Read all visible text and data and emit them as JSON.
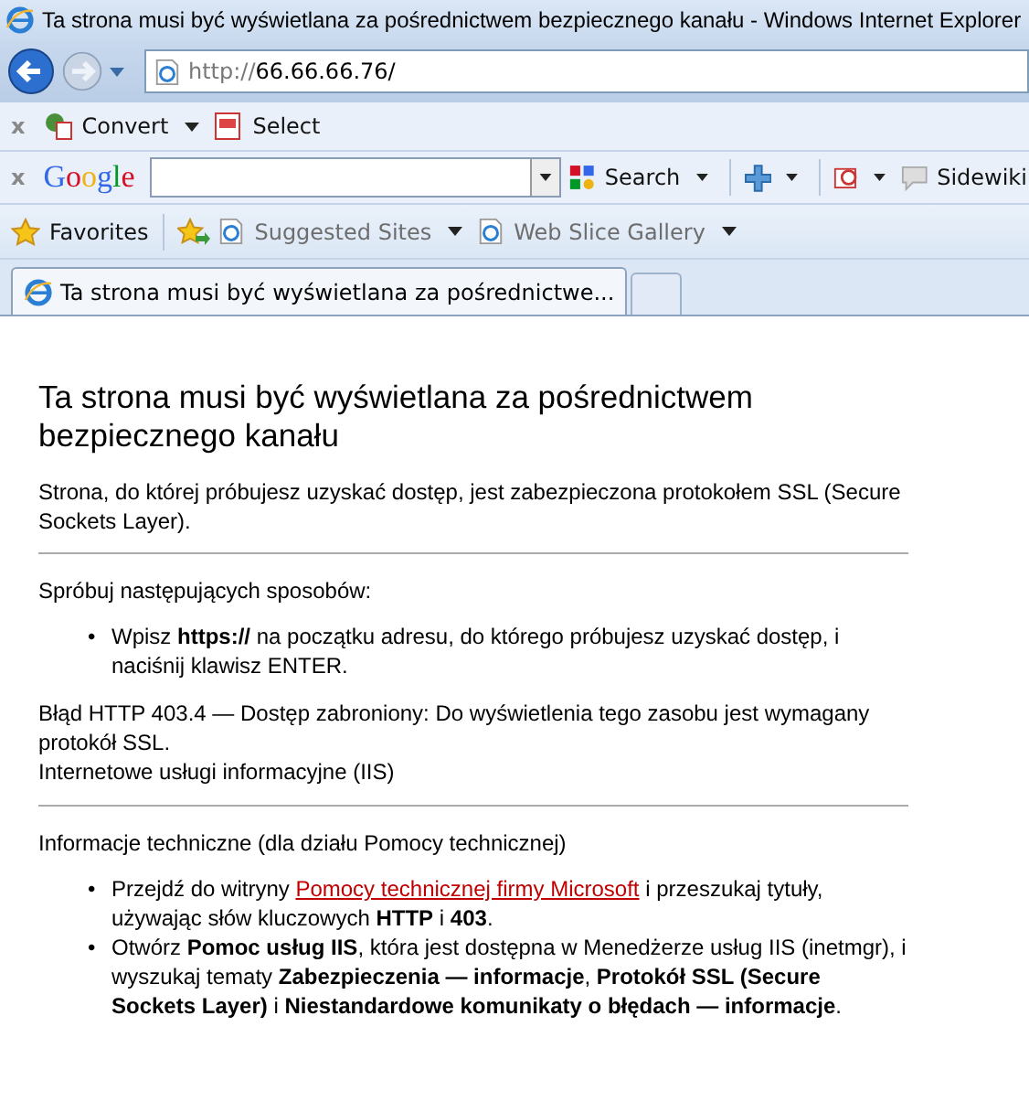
{
  "window": {
    "title": "Ta strona musi być wyświetlana za pośrednictwem bezpiecznego kanału - Windows Internet Explorer"
  },
  "address": {
    "value_dim": "http://",
    "value": "66.66.66.76/"
  },
  "convert_bar": {
    "close": "x",
    "items": [
      {
        "kind": "convert",
        "label": "Convert"
      },
      {
        "kind": "select",
        "label": "Select"
      }
    ]
  },
  "google_bar": {
    "close": "x",
    "logo": "Google",
    "search": "Search",
    "sidewiki": "Sidewiki"
  },
  "favorites_bar": {
    "favorites": "Favorites",
    "links": [
      "Suggested Sites",
      "Web Slice Gallery"
    ]
  },
  "tabs": [
    {
      "label": "Ta strona musi być wyświetlana za pośrednictwe...",
      "selected": true
    }
  ],
  "page": {
    "heading": "Ta strona musi być wyświetlana za pośrednictwem bezpiecznego kanału",
    "intro": "Strona, do której próbujesz uzyskać dostęp, jest zabezpieczona protokołem SSL (Secure Sockets Layer).",
    "try_heading": "Spróbuj następujących sposobów:",
    "try_items": [
      {
        "bullet": "•",
        "text": "Wpisz **https://** na początku adresu, do którego próbujesz uzyskać dostęp, i naciśnij klawisz ENTER."
      }
    ],
    "error": "Błąd HTTP 403.4 — Dostęp zabroniony: Do wyświetlenia tego zasobu jest wymagany protokół SSL.",
    "server": "Internetowe usługi informacyjne (IIS)",
    "tech_heading": "Informacje techniczne (dla działu Pomocy technicznej)",
    "tech_items": [
      {
        "bullet": "•",
        "text": "Przejdź do witryny ",
        "link": "Pomocy technicznej firmy Microsoft",
        "after": " i przeszukaj tytuły, używając słów kluczowych **HTTP** i **403**."
      },
      {
        "bullet": "•",
        "text": "Otwórz **Pomoc usług IIS**, która jest dostępna w Menedżerze usług IIS (inetmgr), i wyszukaj tematy **Zabezpieczenia — informacje**, **Protokół SSL (Secure Sockets Layer)** i **Niestandardowe komunikaty o błędach — informacje**."
      }
    ]
  }
}
